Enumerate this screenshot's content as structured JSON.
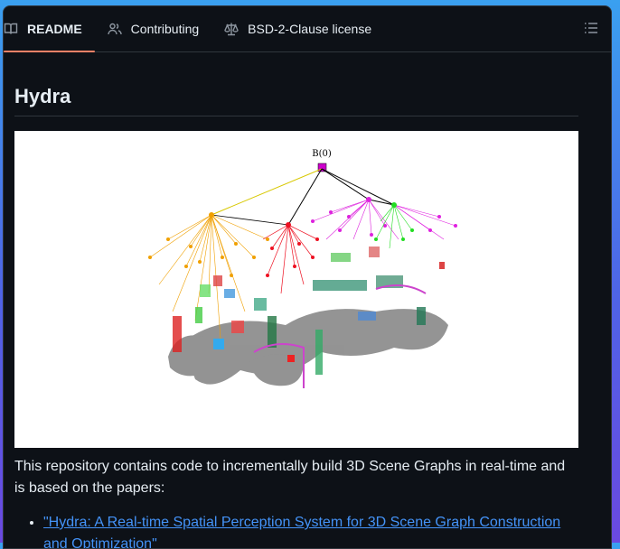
{
  "tabs": [
    {
      "label": "README",
      "icon": "book-icon",
      "active": true
    },
    {
      "label": "Contributing",
      "icon": "people-icon",
      "active": false
    },
    {
      "label": "BSD-2-Clause license",
      "icon": "law-icon",
      "active": false
    }
  ],
  "toc_icon": "list-icon",
  "readme": {
    "title": "Hydra",
    "figure_root_label": "B(0)",
    "intro": "This repository contains code to incrementally build 3D Scene Graphs in real-time and is based on the papers:",
    "papers": [
      {
        "label": "\"Hydra: A Real-time Spatial Perception System for 3D Scene Graph Construction and Optimization\""
      }
    ]
  },
  "colors": {
    "accent_underline": "#f78166",
    "link": "#4493f8",
    "background": "#0d1117"
  }
}
